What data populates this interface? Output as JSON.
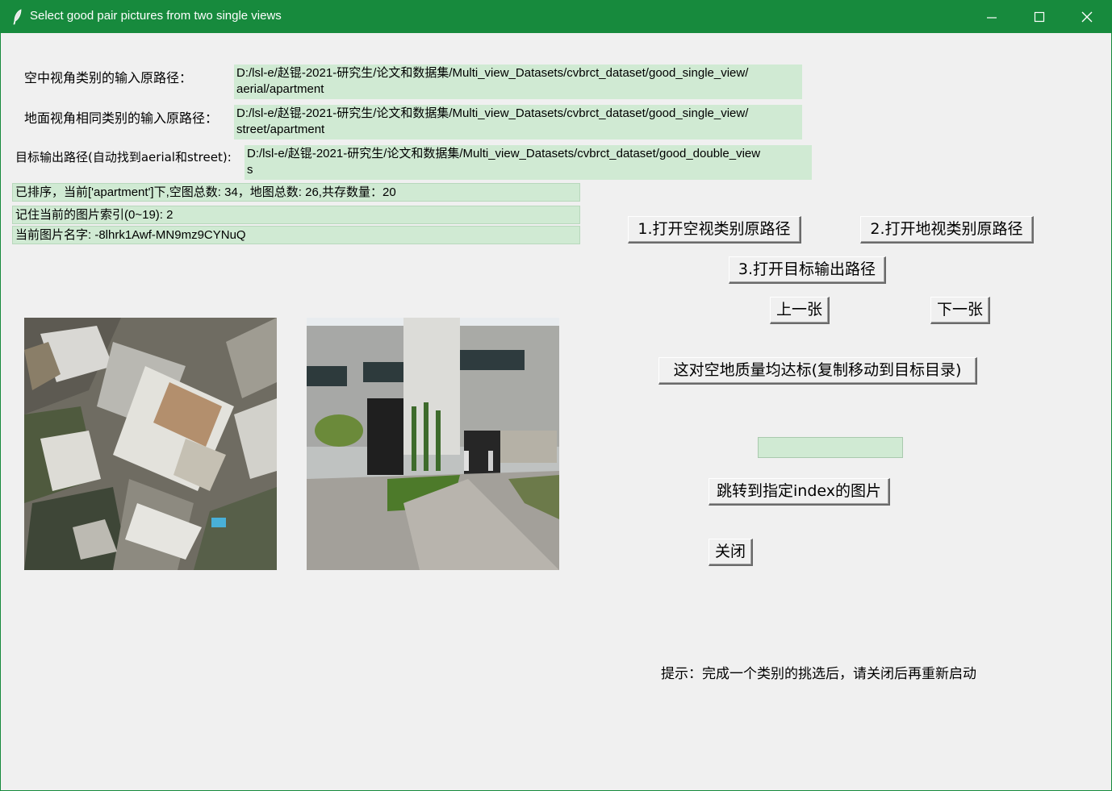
{
  "window": {
    "title": "Select good pair pictures from two single views",
    "icon": "feather-icon",
    "controls": [
      "minimize-icon",
      "maximize-icon",
      "close-icon"
    ],
    "titlebar_color": "#178a3d"
  },
  "paths": {
    "aerial_label": "空中视角类别的输入原路径：",
    "aerial_value_line1": "D:/lsl-e/赵锟-2021-研究生/论文和数据集/Multi_view_Datasets/cvbrct_dataset/good_single_view/",
    "aerial_value_line2": "aerial/apartment",
    "street_label": "地面视角相同类别的输入原路径：",
    "street_value_line1": "D:/lsl-e/赵锟-2021-研究生/论文和数据集/Multi_view_Datasets/cvbrct_dataset/good_single_view/",
    "street_value_line2": "street/apartment",
    "output_label": "目标输出路径(自动找到aerial和street):",
    "output_value_line1": "D:/lsl-e/赵锟-2021-研究生/论文和数据集/Multi_view_Datasets/cvbrct_dataset/good_double_view",
    "output_value_line2": "s"
  },
  "status": {
    "sorted": "已排序，当前['apartment']下,空图总数: 34，地图总数: 26,共存数量：20",
    "index": "记住当前的图片索引(0~19): 2",
    "name": "当前图片名字: -8lhrk1Awf-MN9mz9CYNuQ"
  },
  "buttons": {
    "open_aerial": "1.打开空视类别原路径",
    "open_street": "2.打开地视类别原路径",
    "open_output": "3.打开目标输出路径",
    "prev": "上一张",
    "next": "下一张",
    "approve": "这对空地质量均达标(复制移动到目标目录)",
    "jump": "跳转到指定index的图片",
    "close": "关闭"
  },
  "jump_input": {
    "value": ""
  },
  "hint": "提示：完成一个类别的挑选后，请关闭后再重新启动",
  "colors": {
    "field_bg": "#d0ead3",
    "window_bg": "#f0f0f0"
  }
}
